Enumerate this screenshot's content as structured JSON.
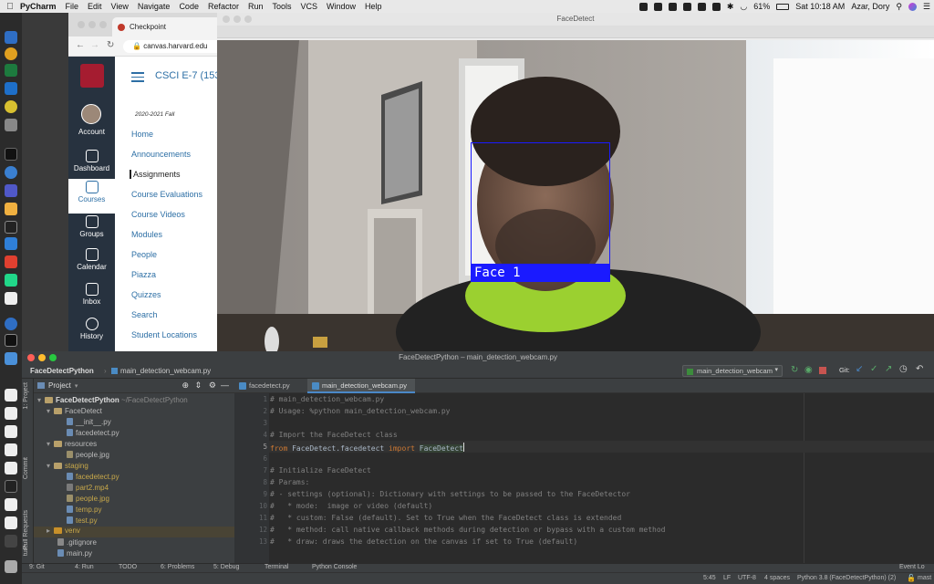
{
  "menubar": {
    "app": "PyCharm",
    "items": [
      "File",
      "Edit",
      "View",
      "Navigate",
      "Code",
      "Refactor",
      "Run",
      "Tools",
      "VCS",
      "Window",
      "Help"
    ],
    "battery": "61%",
    "datetime": "Sat 10:18 AM",
    "user": "Azar, Dory"
  },
  "browser": {
    "tab_title": "Checkpoint",
    "url": "canvas.harvard.edu"
  },
  "canvas": {
    "nav": [
      {
        "label": "Account"
      },
      {
        "label": "Dashboard"
      },
      {
        "label": "Courses"
      },
      {
        "label": "Groups"
      },
      {
        "label": "Calendar"
      },
      {
        "label": "Inbox"
      },
      {
        "label": "History"
      }
    ],
    "course_title": "CSCI E-7 (153",
    "term": "2020-2021 Fall",
    "course_links": [
      "Home",
      "Announcements",
      "Assignments",
      "Course Evaluations",
      "Course Videos",
      "Modules",
      "People",
      "Piazza",
      "Quizzes",
      "Search",
      "Student Locations"
    ],
    "active_link": "Assignments"
  },
  "facedetect": {
    "window_title": "FaceDetect",
    "face_label": "Face 1",
    "box_color": "#1a1aff"
  },
  "pycharm": {
    "window_title": "FaceDetectPython – main_detection_webcam.py",
    "breadcrumb_project": "FaceDetectPython",
    "breadcrumb_file": "main_detection_webcam.py",
    "run_config": "main_detection_webcam",
    "git_label": "Git:",
    "side_tabs": [
      "1: Project",
      "Commit",
      "Pull Requests",
      "ture"
    ],
    "project_header": "Project",
    "tree": [
      {
        "label": "FaceDetectPython",
        "extra": "~/FaceDetectPython",
        "type": "folder",
        "level": 0
      },
      {
        "label": "FaceDetect",
        "type": "folder",
        "level": 1
      },
      {
        "label": "__init__.py",
        "type": "file",
        "level": 2
      },
      {
        "label": "facedetect.py",
        "type": "file",
        "level": 2
      },
      {
        "label": "resources",
        "type": "folder",
        "level": 1
      },
      {
        "label": "people.jpg",
        "type": "file",
        "level": 2
      },
      {
        "label": "staging",
        "type": "folder",
        "level": 1
      },
      {
        "label": "facedetect.py",
        "type": "file",
        "level": 2
      },
      {
        "label": "part2.mp4",
        "type": "file",
        "level": 2
      },
      {
        "label": "people.jpg",
        "type": "file",
        "level": 2
      },
      {
        "label": "temp.py",
        "type": "file",
        "level": 2
      },
      {
        "label": "test.py",
        "type": "file",
        "level": 2
      },
      {
        "label": "venv",
        "type": "folder",
        "level": 1
      },
      {
        "label": ".gitignore",
        "type": "file",
        "level": 1
      },
      {
        "label": "main.py",
        "type": "file",
        "level": 1
      }
    ],
    "editor_tabs": [
      "facedetect.py",
      "main_detection_webcam.py"
    ],
    "code_lines": [
      {
        "n": "1",
        "text": "# main_detection_webcam.py",
        "kind": "comment"
      },
      {
        "n": "2",
        "text": "# Usage: %python main_detection_webcam.py",
        "kind": "comment"
      },
      {
        "n": "3",
        "text": "",
        "kind": "plain"
      },
      {
        "n": "4",
        "text": "# Import the FaceDetect class",
        "kind": "comment"
      },
      {
        "n": "5",
        "text": "from FaceDetect.facedetect import FaceDetect",
        "kind": "import"
      },
      {
        "n": "6",
        "text": "",
        "kind": "plain"
      },
      {
        "n": "7",
        "text": "# Initialize FaceDetect",
        "kind": "comment"
      },
      {
        "n": "8",
        "text": "# Params:",
        "kind": "comment"
      },
      {
        "n": "9",
        "text": "# - settings (optional): Dictionary with settings to be passed to the FaceDetector",
        "kind": "comment"
      },
      {
        "n": "10",
        "text": "#   * mode:  image or video (default)",
        "kind": "comment"
      },
      {
        "n": "11",
        "text": "#   * custom: False (default). Set to True when the FaceDetect class is extended",
        "kind": "comment"
      },
      {
        "n": "12",
        "text": "#   * method: call native callback methods during detection or bypass with a custom method",
        "kind": "comment"
      },
      {
        "n": "13",
        "text": "#   * draw: draws the detection on the canvas if set to True (default)",
        "kind": "comment"
      }
    ],
    "bottom_tools": [
      "9: Git",
      "4: Run",
      "TODO",
      "6: Problems",
      "5: Debug",
      "Terminal",
      "Python Console"
    ],
    "event_log": "Event Lo",
    "status": {
      "pos": "5:45",
      "eol": "LF",
      "enc": "UTF-8",
      "indent": "4 spaces",
      "interp": "Python 3.8 (FaceDetectPython) (2)",
      "branch": "mast"
    }
  }
}
